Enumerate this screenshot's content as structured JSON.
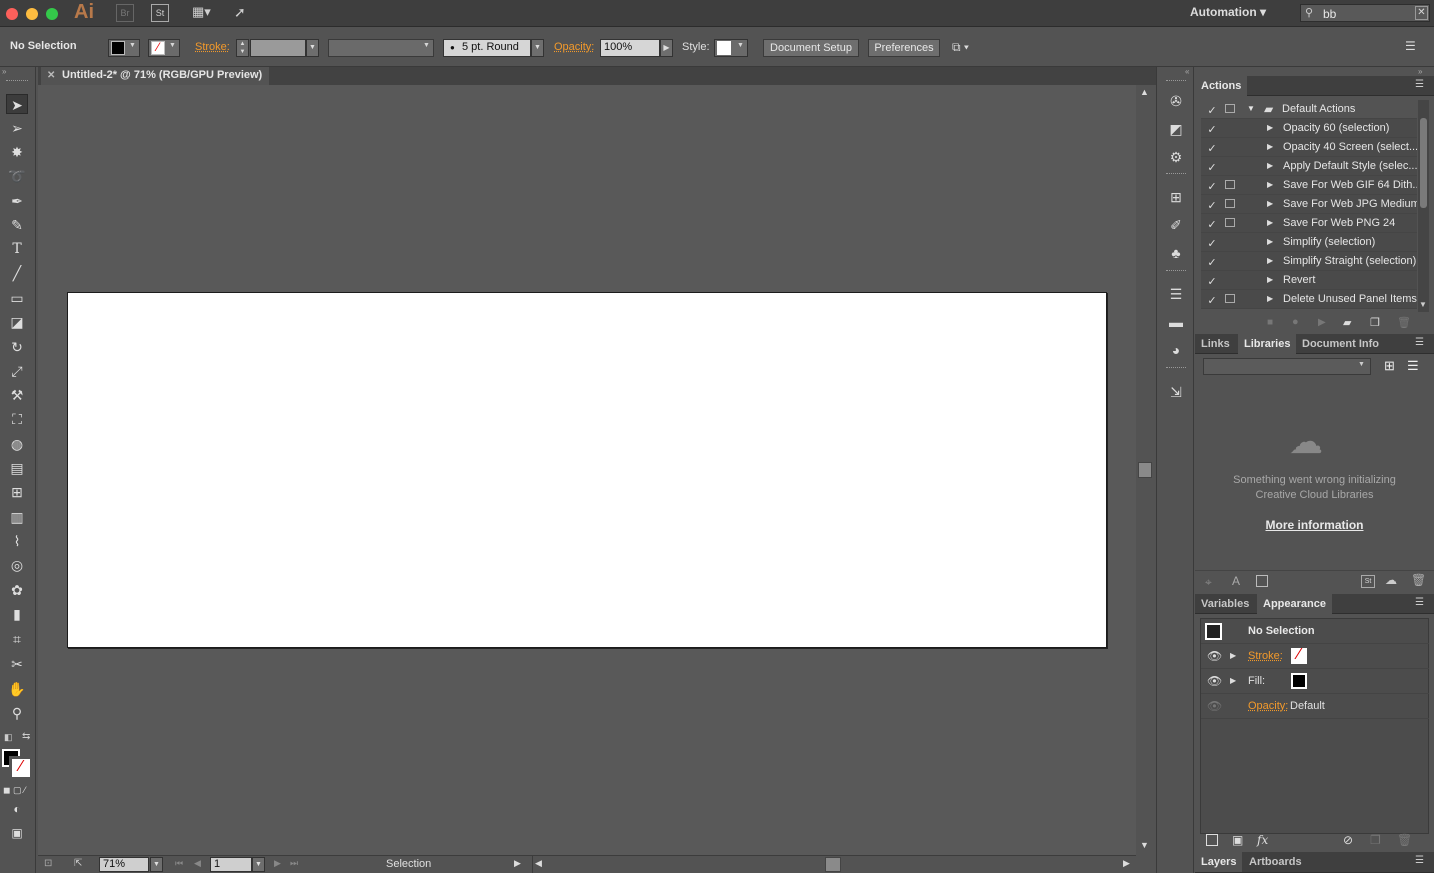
{
  "titlebar": {
    "app_logo": "Ai",
    "bridge": "Br",
    "stock": "St",
    "workspace": "Automation",
    "search_value": "bb"
  },
  "control": {
    "selection_label": "No Selection",
    "stroke_label": "Stroke:",
    "brush_label": "5 pt. Round",
    "opacity_label": "Opacity:",
    "opacity_value": "100%",
    "style_label": "Style:",
    "doc_setup": "Document Setup",
    "preferences": "Preferences"
  },
  "document": {
    "tab_title": "Untitled-2* @ 71% (RGB/GPU Preview)"
  },
  "status": {
    "zoom": "71%",
    "artboard_num": "1",
    "tool": "Selection"
  },
  "actions_panel": {
    "title": "Actions",
    "set_name": "Default Actions",
    "items": [
      {
        "label": "Opacity 60 (selection)",
        "dialog": false
      },
      {
        "label": "Opacity 40 Screen (select...",
        "dialog": false
      },
      {
        "label": "Apply Default Style (selec...",
        "dialog": false
      },
      {
        "label": "Save For Web GIF 64 Dith...",
        "dialog": true
      },
      {
        "label": "Save For Web JPG Medium",
        "dialog": true
      },
      {
        "label": "Save For Web PNG 24",
        "dialog": true
      },
      {
        "label": "Simplify (selection)",
        "dialog": false
      },
      {
        "label": "Simplify Straight (selection)",
        "dialog": false
      },
      {
        "label": "Revert",
        "dialog": false
      },
      {
        "label": "Delete Unused Panel Items",
        "dialog": true
      }
    ]
  },
  "libraries_panel": {
    "tabs": [
      "Links",
      "Libraries",
      "Document Info"
    ],
    "active_tab": "Libraries",
    "error_line1": "Something went wrong initializing",
    "error_line2": "Creative Cloud Libraries",
    "more_info": "More information"
  },
  "appearance_panel": {
    "tabs": [
      "Variables",
      "Appearance"
    ],
    "active_tab": "Appearance",
    "selection": "No Selection",
    "stroke_label": "Stroke:",
    "fill_label": "Fill:",
    "opacity_label": "Opacity:",
    "opacity_value": "Default"
  },
  "bottom_panel": {
    "tabs": [
      "Layers",
      "Artboards"
    ]
  },
  "colors": {
    "accent_orange": "#f39a2b",
    "chrome": "#535353",
    "canvas": "#595959"
  }
}
